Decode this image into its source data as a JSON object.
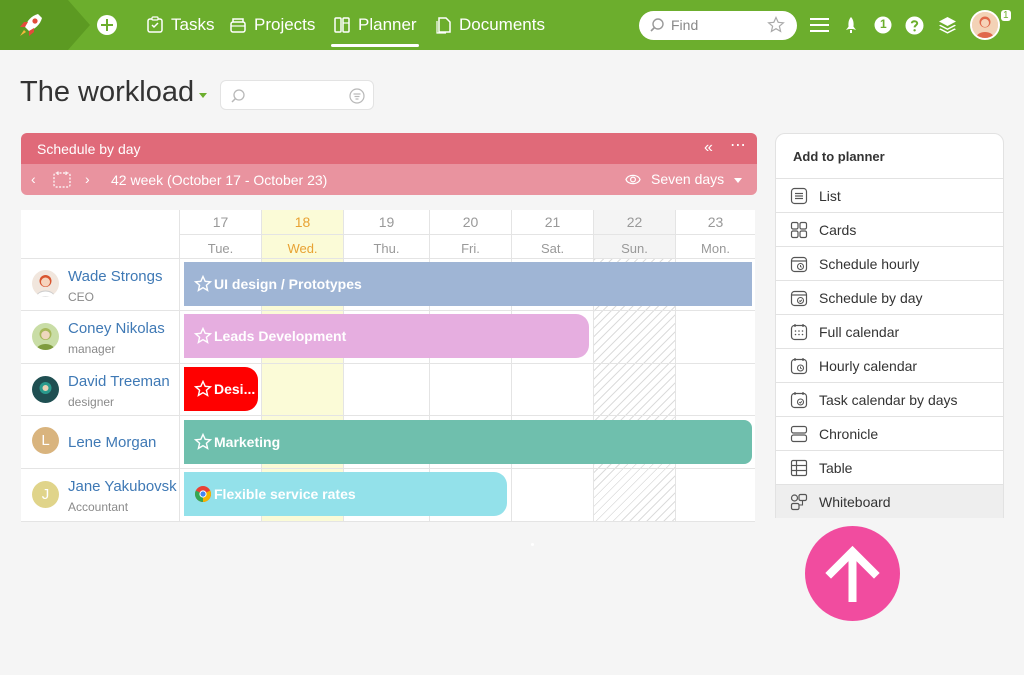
{
  "colors": {
    "brand": "#6cae2d",
    "schedule_header": "#e06a79",
    "today": "#e8a233",
    "link": "#3f79b5",
    "fab": "#f14c9f"
  },
  "nav": {
    "items": [
      {
        "label": "Tasks",
        "icon": "tasks-icon"
      },
      {
        "label": "Projects",
        "icon": "projects-icon"
      },
      {
        "label": "Planner",
        "icon": "planner-icon",
        "active": true
      },
      {
        "label": "Documents",
        "icon": "documents-icon"
      }
    ],
    "search_placeholder": "Find",
    "notifications_badge": "1",
    "user_badge": "1"
  },
  "page": {
    "title": "The workload"
  },
  "schedule": {
    "title": "Schedule by day",
    "week_label": "42 week  (October 17 - October 23)",
    "range_label": "Seven days",
    "days": [
      {
        "num": "17",
        "name": "Tue."
      },
      {
        "num": "18",
        "name": "Wed.",
        "today": true
      },
      {
        "num": "19",
        "name": "Thu."
      },
      {
        "num": "20",
        "name": "Fri."
      },
      {
        "num": "21",
        "name": "Sat."
      },
      {
        "num": "22",
        "name": "Sun.",
        "weekend": true
      },
      {
        "num": "23",
        "name": "Mon."
      }
    ],
    "people": [
      {
        "name": "Wade Strongs",
        "role": "CEO",
        "avatar": "photo"
      },
      {
        "name": "Coney Nikolas",
        "role": "manager",
        "avatar": "photo"
      },
      {
        "name": "David Treeman",
        "role": "designer",
        "avatar": "photo"
      },
      {
        "name": "Lene Morgan",
        "role": "",
        "avatar": "L"
      },
      {
        "name": "Jane Yakubovsk",
        "role": "Accountant",
        "avatar": "J"
      }
    ],
    "tasks": [
      {
        "label": "UI design / Prototypes",
        "color": "#9fb5d5",
        "icon": "star-icon"
      },
      {
        "label": "Leads Development",
        "color": "#e6aee0",
        "icon": "star-icon"
      },
      {
        "label": "Desi...",
        "color": "#ff0000",
        "icon": "star-icon"
      },
      {
        "label": "Marketing",
        "color": "#6fbfad",
        "icon": "star-icon"
      },
      {
        "label": "Flexible service rates",
        "color": "#93e1ea",
        "icon": "chrome-icon"
      }
    ]
  },
  "planner_panel": {
    "title": "Add to planner",
    "items": [
      {
        "label": "List",
        "icon": "list-icon"
      },
      {
        "label": "Cards",
        "icon": "cards-icon"
      },
      {
        "label": "Schedule hourly",
        "icon": "schedule-hourly-icon"
      },
      {
        "label": "Schedule by day",
        "icon": "schedule-day-icon"
      },
      {
        "label": "Full calendar",
        "icon": "full-calendar-icon"
      },
      {
        "label": "Hourly calendar",
        "icon": "hourly-calendar-icon"
      },
      {
        "label": "Task calendar by days",
        "icon": "task-calendar-icon"
      },
      {
        "label": "Chronicle",
        "icon": "chronicle-icon"
      },
      {
        "label": "Table",
        "icon": "table-icon"
      },
      {
        "label": "Whiteboard",
        "icon": "whiteboard-icon",
        "hovered": true
      }
    ]
  }
}
